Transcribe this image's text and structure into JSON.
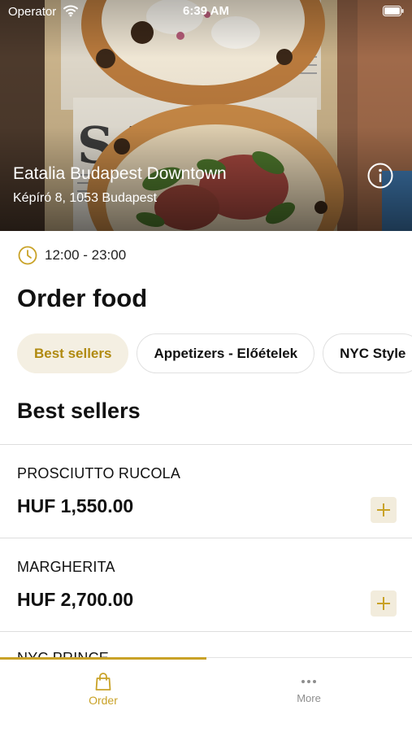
{
  "status_bar": {
    "carrier": "Operator",
    "time": "6:39 AM"
  },
  "restaurant": {
    "name": "Eatalia Budapest Downtown",
    "address": "Képíró 8, 1053 Budapest"
  },
  "hours": {
    "text": "12:00 - 23:00"
  },
  "page": {
    "title": "Order food"
  },
  "categories": [
    {
      "label": "Best sellers",
      "active": true
    },
    {
      "label": "Appetizers - Előételek",
      "active": false
    },
    {
      "label": "NYC Style",
      "active": false
    }
  ],
  "section": {
    "title": "Best sellers"
  },
  "items": [
    {
      "name": "PROSCIUTTO RUCOLA",
      "price": "HUF 1,550.00"
    },
    {
      "name": "MARGHERITA",
      "price": "HUF 2,700.00"
    },
    {
      "name": "NYC PRINCE",
      "price": ""
    }
  ],
  "tabbar": {
    "order_label": "Order",
    "more_label": "More"
  },
  "colors": {
    "accent": "#c9a227",
    "chip_active_bg": "#f4efe2",
    "add_button_bg": "#f2ecdc"
  }
}
